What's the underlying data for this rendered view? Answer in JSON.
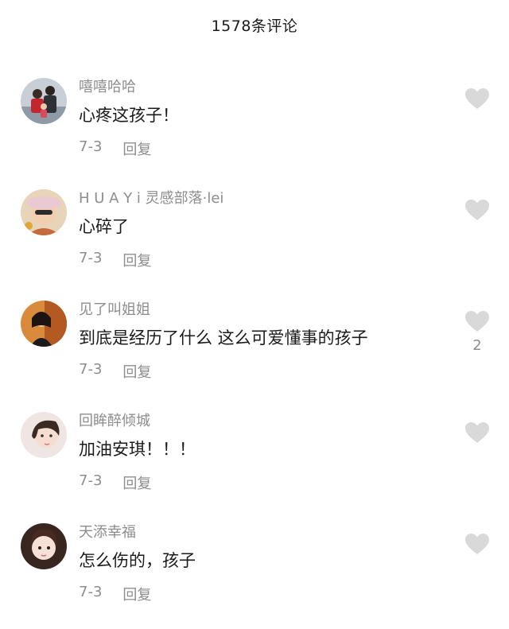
{
  "header": {
    "title": "1578条评论"
  },
  "comments": [
    {
      "username": "嘻嘻哈哈",
      "text": "心疼这孩子！",
      "date": "7-3",
      "reply_label": "回复",
      "likes": ""
    },
    {
      "username": "H U A Y i 灵感部落·lei",
      "text": "心碎了",
      "date": "7-3",
      "reply_label": "回复",
      "likes": ""
    },
    {
      "username": "见了叫姐姐",
      "text": "到底是经历了什么 这么可爱懂事的孩子",
      "date": "7-3",
      "reply_label": "回复",
      "likes": "2"
    },
    {
      "username": "回眸醉倾城",
      "text": "加油安琪！！！",
      "date": "7-3",
      "reply_label": "回复",
      "likes": ""
    },
    {
      "username": "天添幸福",
      "text": "怎么伤的，孩子",
      "date": "7-3",
      "reply_label": "回复",
      "likes": ""
    }
  ],
  "colors": {
    "like_icon": "#d9d9d9",
    "secondary_text": "#8d8d8d",
    "primary_text": "#1b1b1b"
  }
}
